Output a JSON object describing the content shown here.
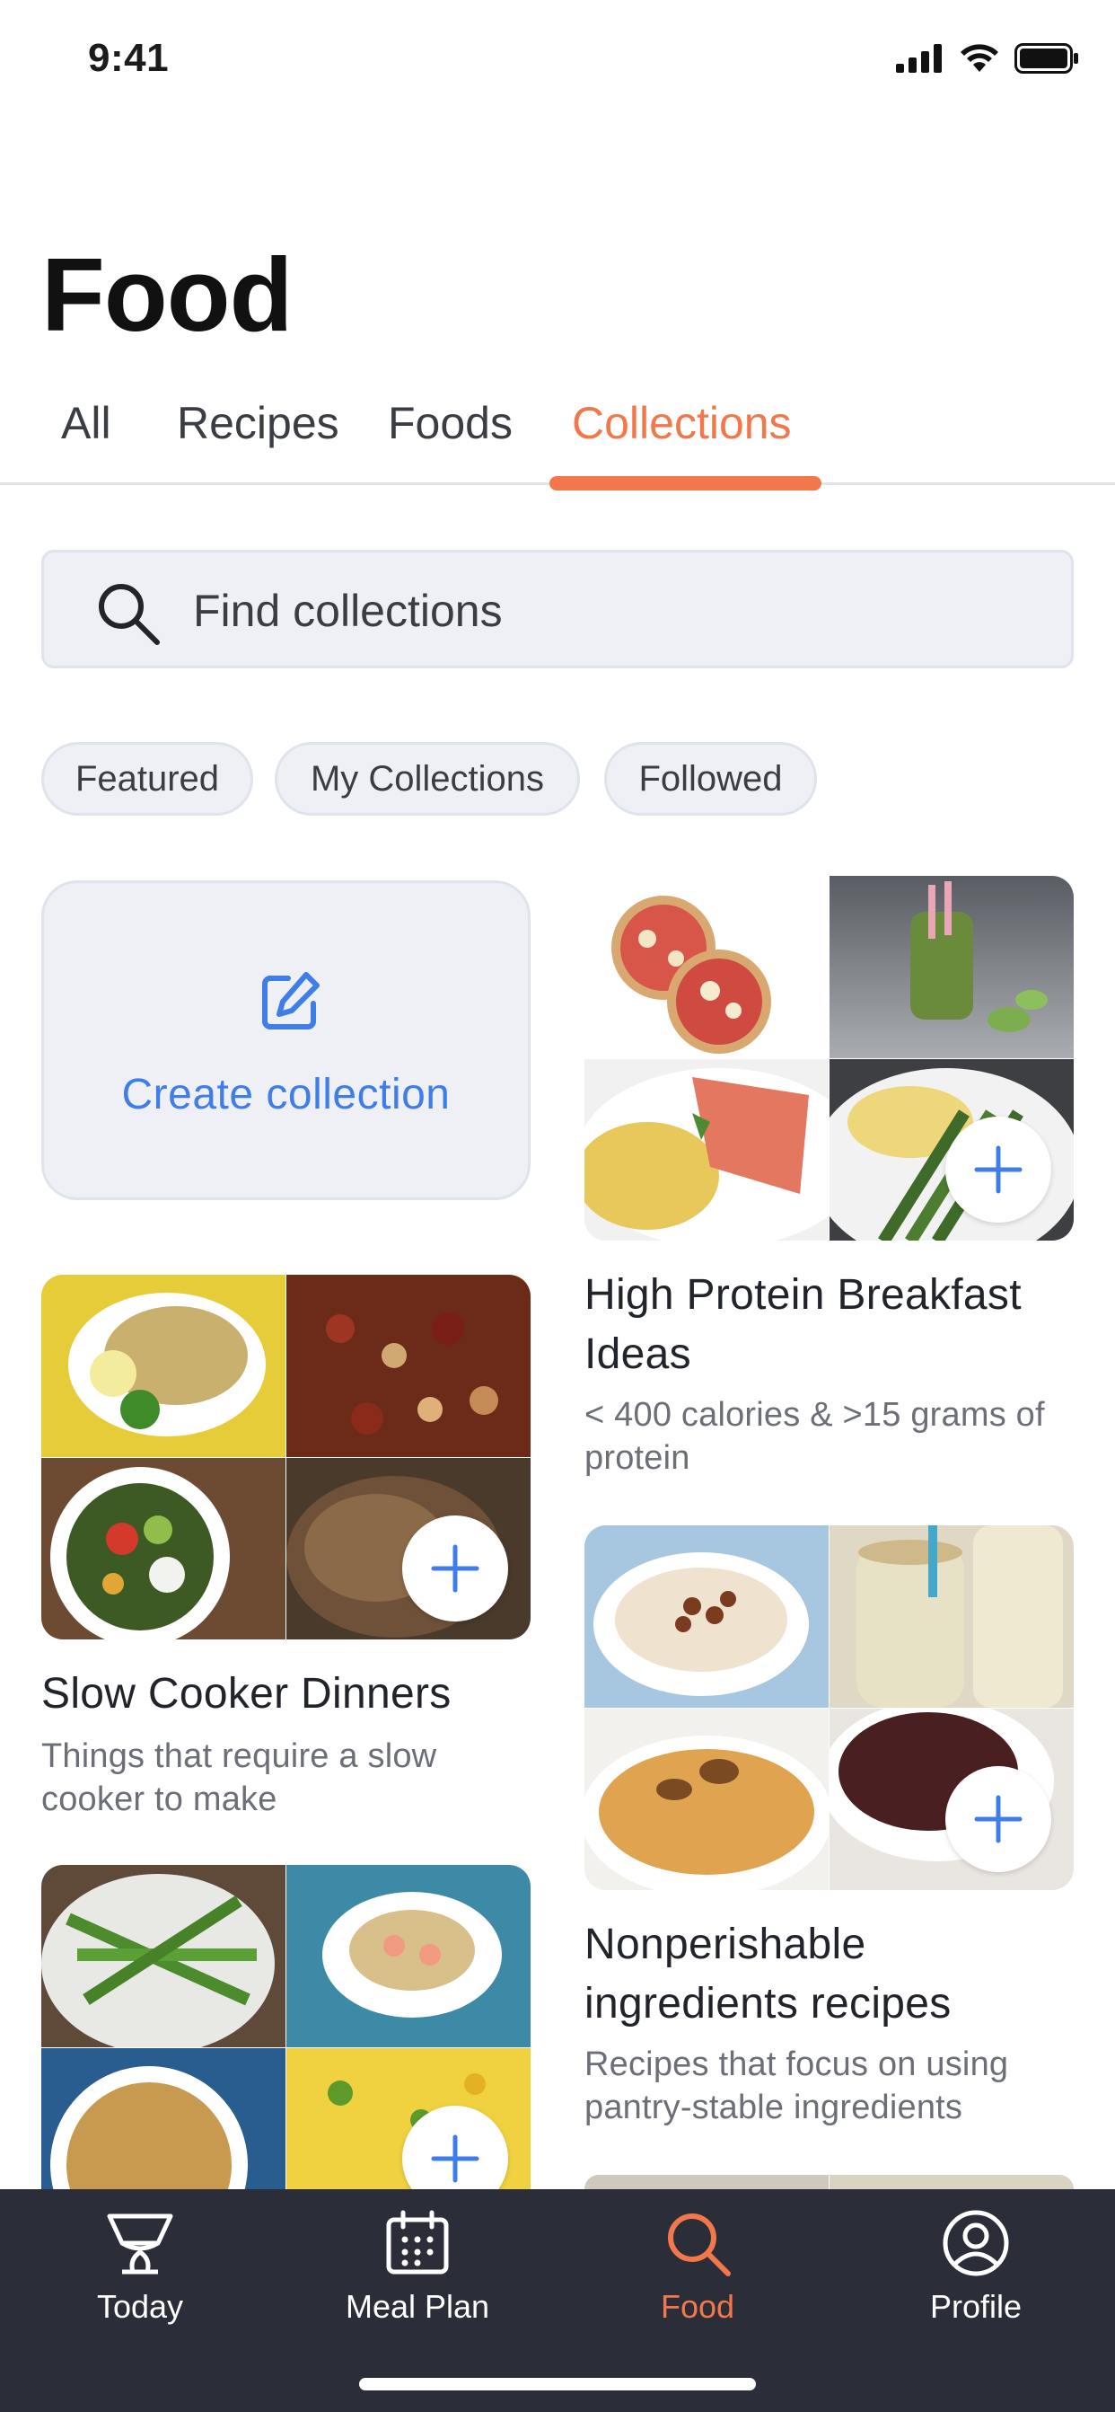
{
  "status_bar": {
    "time": "9:41",
    "icons": [
      "signal-icon",
      "wifi-icon",
      "battery-icon"
    ]
  },
  "header": {
    "title": "Food"
  },
  "tabs": [
    {
      "label": "All",
      "active": false
    },
    {
      "label": "Recipes",
      "active": false
    },
    {
      "label": "Foods",
      "active": false
    },
    {
      "label": "Collections",
      "active": true
    }
  ],
  "search": {
    "placeholder": "Find collections",
    "value": ""
  },
  "filters": [
    "Featured",
    "My Collections",
    "Followed"
  ],
  "create_card": {
    "label": "Create collection",
    "icon": "edit-icon"
  },
  "collections": [
    {
      "title": "High Protein Breakfast Ideas",
      "description": "< 400 calories & >15 grams of protein"
    },
    {
      "title": "Slow Cooker Dinners",
      "description": "Things that require a slow cooker to make"
    },
    {
      "title": "Nonperishable ingredients recipes",
      "description": "Recipes that focus on using pantry-stable ingredients"
    }
  ],
  "bottom_nav": [
    {
      "label": "Today",
      "icon": "today-icon",
      "active": false
    },
    {
      "label": "Meal Plan",
      "icon": "calendar-icon",
      "active": false
    },
    {
      "label": "Food",
      "icon": "search-icon",
      "active": true
    },
    {
      "label": "Profile",
      "icon": "profile-icon",
      "active": false
    }
  ],
  "colors": {
    "accent": "#f2784b",
    "link": "#3f7de8",
    "nav_bg": "#2b2e38",
    "chip_bg": "#eef0f5"
  }
}
